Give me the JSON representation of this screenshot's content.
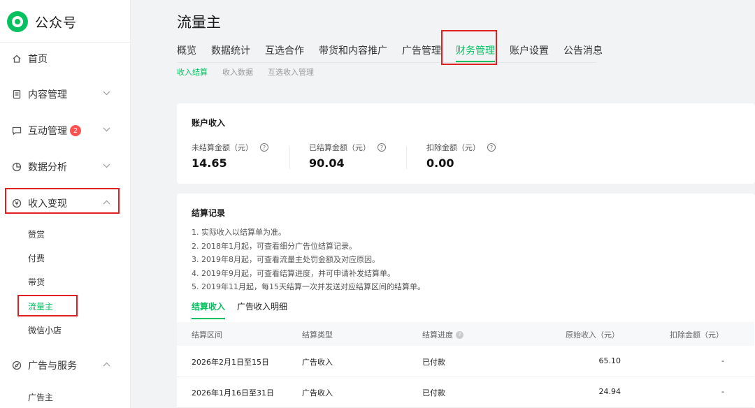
{
  "app": {
    "name": "公众号"
  },
  "sidebar": {
    "items": [
      {
        "label": "首页",
        "icon": "home-icon"
      },
      {
        "label": "内容管理",
        "icon": "document-icon"
      },
      {
        "label": "互动管理",
        "icon": "chat-icon",
        "badge": "2"
      },
      {
        "label": "数据分析",
        "icon": "pie-chart-icon"
      },
      {
        "label": "收入变现",
        "icon": "yuan-icon"
      },
      {
        "label": "广告与服务",
        "icon": "compass-icon"
      }
    ],
    "income_sub": [
      "赞赏",
      "付费",
      "带货",
      "流量主",
      "微信小店"
    ],
    "ad_sub": [
      "广告主"
    ]
  },
  "page": {
    "title": "流量主",
    "tabs": [
      "概览",
      "数据统计",
      "互选合作",
      "带货和内容推广",
      "广告管理",
      "财务管理",
      "账户设置",
      "公告消息"
    ],
    "active_tab": "财务管理",
    "subtabs": [
      "收入结算",
      "收入数据",
      "互选收入管理"
    ],
    "active_subtab": "收入结算"
  },
  "account": {
    "title": "账户收入",
    "stats": [
      {
        "label": "未结算金额（元）",
        "value": "14.65"
      },
      {
        "label": "已结算金额（元）",
        "value": "90.04"
      },
      {
        "label": "扣除金额（元）",
        "value": "0.00"
      }
    ]
  },
  "settlement": {
    "title": "结算记录",
    "notes": [
      "1. 实际收入以结算单为准。",
      "2. 2018年1月起，可查看细分广告位结算记录。",
      "3. 2019年8月起，可查看流量主处罚金额及对应原因。",
      "4. 2019年9月起，可查看结算进度，并可申请补发结算单。",
      "5. 2019年11月起，每15天结算一次并发送对应结算区间的结算单。"
    ],
    "tabs": [
      "结算收入",
      "广告收入明细"
    ],
    "columns": [
      "结算区间",
      "结算类型",
      "结算进度",
      "原始收入（元）",
      "扣除金额（元）"
    ],
    "rows": [
      {
        "period": "2026年2月1日至15日",
        "type": "广告收入",
        "status": "已付款",
        "income": "65.10",
        "deduction": "-"
      },
      {
        "period": "2026年1月16日至31日",
        "type": "广告收入",
        "status": "已付款",
        "income": "24.94",
        "deduction": "-"
      }
    ]
  },
  "colors": {
    "accent": "#07c160",
    "highlight": "#e02020",
    "badge": "#fa5151"
  }
}
